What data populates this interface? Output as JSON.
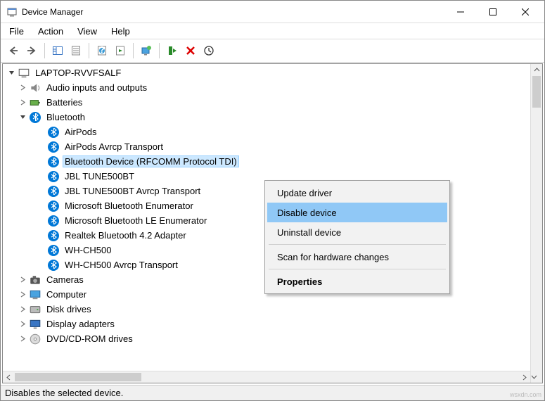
{
  "window": {
    "title": "Device Manager"
  },
  "menubar": [
    "File",
    "Action",
    "View",
    "Help"
  ],
  "tree": {
    "root": "LAPTOP-RVVFSALF",
    "audio": "Audio inputs and outputs",
    "batteries": "Batteries",
    "bluetooth": "Bluetooth",
    "bt_items": [
      "AirPods",
      "AirPods Avrcp Transport",
      "Bluetooth Device (RFCOMM Protocol TDI)",
      "JBL TUNE500BT",
      "JBL TUNE500BT Avrcp Transport",
      "Microsoft Bluetooth Enumerator",
      "Microsoft Bluetooth LE Enumerator",
      "Realtek Bluetooth 4.2 Adapter",
      "WH-CH500",
      "WH-CH500 Avrcp Transport"
    ],
    "cameras": "Cameras",
    "computer": "Computer",
    "disk": "Disk drives",
    "display": "Display adapters",
    "dvd": "DVD/CD-ROM drives"
  },
  "context_menu": {
    "update": "Update driver",
    "disable": "Disable device",
    "uninstall": "Uninstall device",
    "scan": "Scan for hardware changes",
    "properties": "Properties"
  },
  "status": "Disables the selected device.",
  "watermark": "wsxdn.com"
}
